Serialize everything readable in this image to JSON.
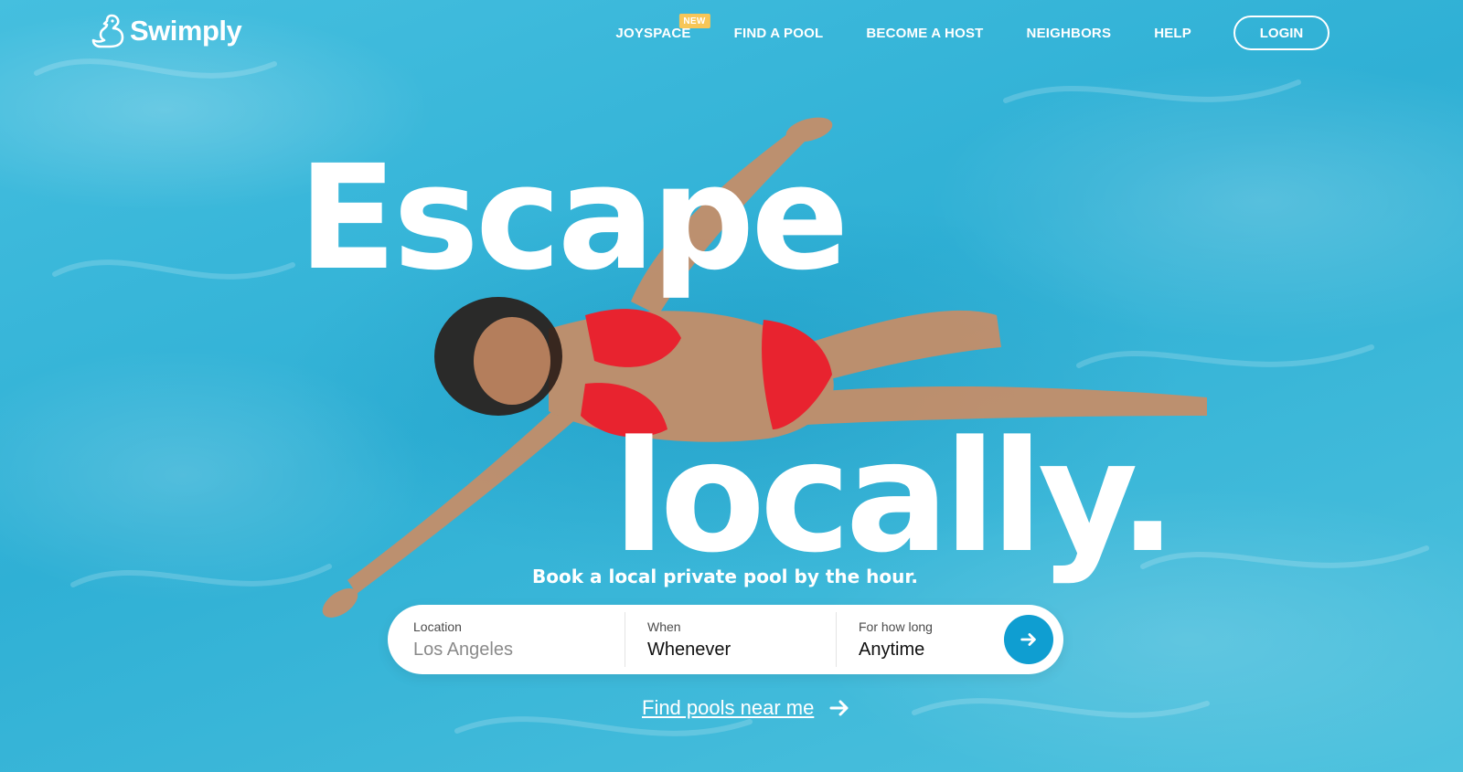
{
  "brand": {
    "name": "Swimply"
  },
  "nav": {
    "items": [
      {
        "label": "JOYSPACE",
        "badge": "NEW"
      },
      {
        "label": "FIND A POOL"
      },
      {
        "label": "BECOME A HOST"
      },
      {
        "label": "NEIGHBORS"
      },
      {
        "label": "HELP"
      }
    ],
    "login_label": "LOGIN"
  },
  "hero": {
    "headline_line1": "Escape",
    "headline_line2": "locally.",
    "tagline": "Book a local private pool by the hour."
  },
  "search": {
    "location_label": "Location",
    "location_placeholder": "Los Angeles",
    "when_label": "When",
    "when_value": "Whenever",
    "duration_label": "For how long",
    "duration_value": "Anytime",
    "submit_icon": "arrow-right-icon"
  },
  "near_me": {
    "label": "Find pools near me",
    "icon": "arrow-right-icon"
  },
  "colors": {
    "water": "#3cb6d6",
    "accent": "#0f9ed1",
    "badge": "#f7c657",
    "swimsuit": "#e8232f"
  }
}
